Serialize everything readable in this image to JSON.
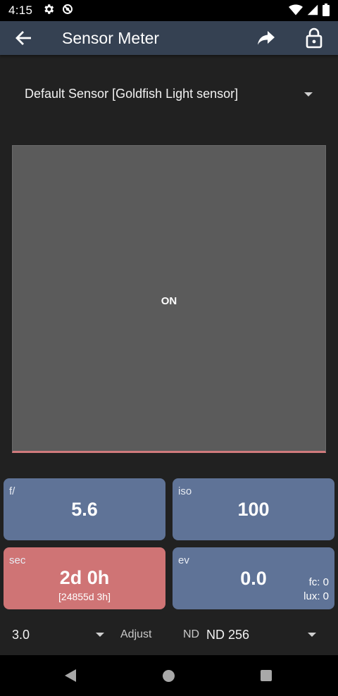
{
  "status_bar": {
    "time": "4:15",
    "icons": [
      "gear-icon",
      "do-not-disturb-icon",
      "wifi-icon",
      "signal-icon",
      "battery-icon"
    ]
  },
  "app_bar": {
    "title": "Sensor Meter",
    "icons": [
      "back-arrow-icon",
      "share-icon",
      "lock-icon"
    ]
  },
  "sensor_select": {
    "value": "Default Sensor [Goldfish Light sensor]"
  },
  "meter": {
    "state": "ON",
    "colors": {
      "panel": "#5b5b5b",
      "indicator_line": "#d07a7c"
    }
  },
  "tiles": {
    "aperture": {
      "label": "f/",
      "value": "5.6"
    },
    "iso": {
      "label": "iso",
      "value": "100"
    },
    "shutter": {
      "label": "sec",
      "value": "2d 0h",
      "sub": "[24855d 3h]"
    },
    "ev": {
      "label": "ev",
      "value": "0.0",
      "fc": "fc: 0",
      "lux": "lux: 0"
    }
  },
  "tile_colors": {
    "blue": "#5f7397",
    "red": "#cf7475"
  },
  "bottom_controls": {
    "step_value": "3.0",
    "adjust_label": "Adjust",
    "nd_label": "ND",
    "nd_value": "ND 256"
  },
  "nav_bar": {
    "icons": [
      "nav-back-icon",
      "nav-home-icon",
      "nav-recents-icon"
    ]
  }
}
